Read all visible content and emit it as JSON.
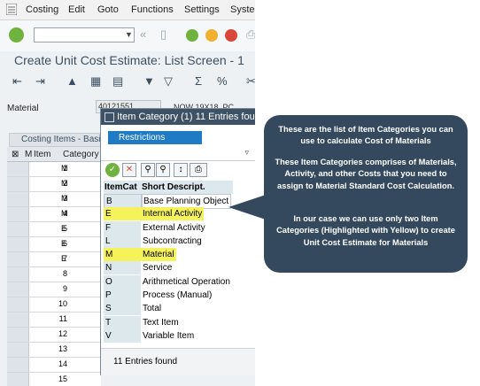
{
  "menu": [
    "Costing",
    "Edit",
    "Goto",
    "Functions",
    "Settings",
    "Syster"
  ],
  "title": "Create Unit Cost Estimate: List Screen - 1",
  "material": {
    "label": "Material",
    "value": "40121551",
    "description": "NOW 19X18, PC"
  },
  "costing_tab": "Costing Items - Basic",
  "grid_header": {
    "item": "Item",
    "category": "Category",
    "sel_a": "⊠",
    "sel_b": "M"
  },
  "rows": [
    {
      "item": "1",
      "cat": "M"
    },
    {
      "item": "2",
      "cat": "M"
    },
    {
      "item": "3",
      "cat": "M"
    },
    {
      "item": "4",
      "cat": "M"
    },
    {
      "item": "5",
      "cat": "E"
    },
    {
      "item": "6",
      "cat": "E"
    },
    {
      "item": "7",
      "cat": "E"
    },
    {
      "item": "8",
      "cat": ""
    },
    {
      "item": "9",
      "cat": ""
    },
    {
      "item": "10",
      "cat": ""
    },
    {
      "item": "11",
      "cat": ""
    },
    {
      "item": "12",
      "cat": ""
    },
    {
      "item": "13",
      "cat": ""
    },
    {
      "item": "14",
      "cat": ""
    },
    {
      "item": "15",
      "cat": ""
    }
  ],
  "popup": {
    "title": "Item Category (1)   11 Entries found",
    "restrictions": "Restrictions",
    "col_key": "ItemCat",
    "col_desc": "Short Descript.",
    "items": [
      {
        "key": "B",
        "desc": "Base Planning Object",
        "highlight": false
      },
      {
        "key": "E",
        "desc": "Internal Activity",
        "highlight": true
      },
      {
        "key": "F",
        "desc": "External Activity",
        "highlight": false
      },
      {
        "key": "L",
        "desc": "Subcontracting",
        "highlight": false
      },
      {
        "key": "M",
        "desc": "Material",
        "highlight": true
      },
      {
        "key": "N",
        "desc": "Service",
        "highlight": false
      },
      {
        "key": "O",
        "desc": "Arithmetical Operation",
        "highlight": false
      },
      {
        "key": "P",
        "desc": "Process (Manual)",
        "highlight": false
      },
      {
        "key": "S",
        "desc": "Total",
        "highlight": false
      },
      {
        "key": "T",
        "desc": "Text Item",
        "highlight": false
      },
      {
        "key": "V",
        "desc": "Variable Item",
        "highlight": false
      }
    ],
    "footer": "11 Entries found"
  },
  "callout": {
    "p1": "These are the list of Item Categories you can use to calculate Cost of Materials",
    "p2": "These Item Categories comprises of Materials, Activity, and other Costs that you need to assign to Material Standard Cost Calculation.",
    "p3": "In our case we can use only two Item Categories (Highlighted with Yellow) to create Unit Cost Estimate for Materials"
  },
  "colors": {
    "highlight": "#f6f25a",
    "callout": "#34495e",
    "popup_title": "#3d5365",
    "restrictions": "#1e7bc4"
  }
}
